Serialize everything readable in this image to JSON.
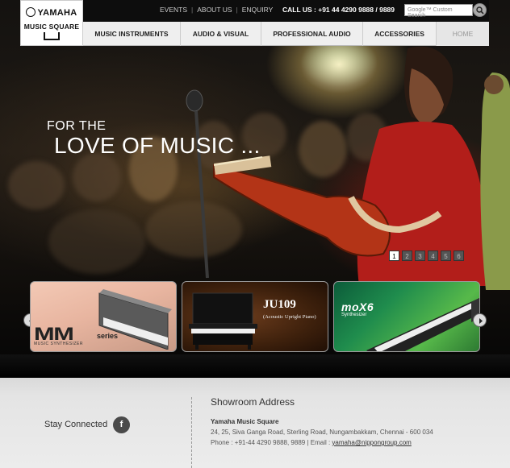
{
  "logo": {
    "brand": "YAMAHA",
    "sub": "MUSIC SQUARE"
  },
  "toplinks": [
    "EVENTS",
    "ABOUT US",
    "ENQUIRY"
  ],
  "callus": "CALL US : +91 44 4290 9888 / 9889",
  "search": {
    "placeholder": "Google™ Custom Search"
  },
  "nav": [
    "MUSIC INSTRUMENTS",
    "AUDIO & VISUAL",
    "PROFESSIONAL AUDIO",
    "ACCESSORIES",
    "HOME"
  ],
  "hero": {
    "line1": "FOR THE",
    "line2": "LOVE OF MUSIC ..."
  },
  "pager": [
    "1",
    "2",
    "3",
    "4",
    "5",
    "6"
  ],
  "pager_active": "1",
  "cards": {
    "mm": {
      "title": "MM",
      "series": "series",
      "sub": "MUSIC SYNTHESIZER"
    },
    "ju": {
      "title": "JU109",
      "sub": "(Acoustic Upright Piano)"
    },
    "mox": {
      "title": "moX6",
      "sub": "Synthesizer"
    }
  },
  "footer": {
    "stay": "Stay Connected",
    "fb": "f",
    "showroom": "Showroom Address",
    "name": "Yamaha Music Square",
    "address": "24, 25, Siva Ganga Road, Sterling Road, Nungambakkam, Chennai - 600 034",
    "phone": "Phone : +91-44 4290 9888, 9889 | Email : ",
    "email": "yamaha@nippongroup.com"
  },
  "colors": {
    "nav_bg": "#efefef",
    "footer_bg": "#e4e4e4",
    "accent_green": "#1f8c4d"
  }
}
